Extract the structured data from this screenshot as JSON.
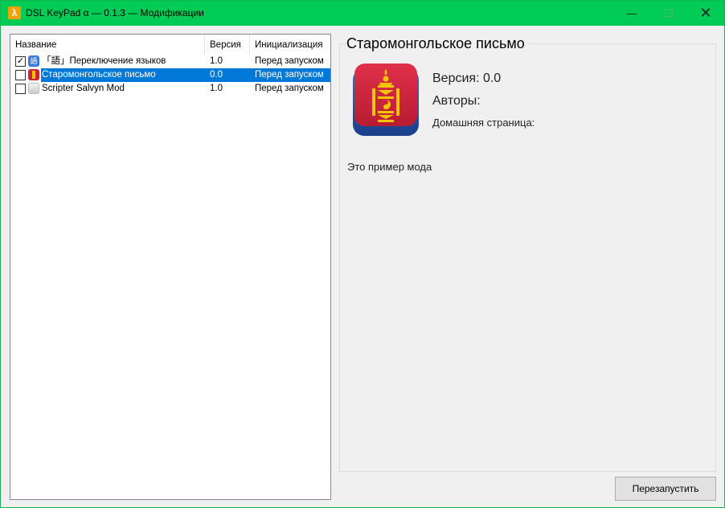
{
  "window": {
    "title": "DSL KeyPad α — 0.1.3 — Модификации",
    "app_icon_glyph": "λ",
    "minimize_glyph": "—",
    "maximize_glyph": "☐",
    "close_glyph": "✕",
    "titlebar_color": "#00cc55"
  },
  "list": {
    "columns": [
      "Название",
      "Версия",
      "Инициализация"
    ],
    "rows": [
      {
        "checked": "✓",
        "icon": "language-switch-icon",
        "icon_glyph": "語",
        "name": "「語」Переключение языков",
        "version": "1.0",
        "init": "Перед запуском"
      },
      {
        "checked": "",
        "icon": "mongolian-soyombo-icon",
        "icon_glyph": "",
        "name": "Старомонгольское письмо",
        "version": "0.0",
        "init": "Перед запуском"
      },
      {
        "checked": "",
        "icon": "script-icon",
        "icon_glyph": "",
        "name": "Scripter Salvyn Mod",
        "version": "1.0",
        "init": "Перед запуском"
      }
    ],
    "selected_row_color": "#0078d7"
  },
  "details": {
    "title": "Старомонгольское письмо",
    "version_line": "Версия: 0.0",
    "authors_line": "Авторы:",
    "homepage_line": "Домашняя страница:",
    "description": "Это пример мода"
  },
  "actions": {
    "restart_label": "Перезапустить"
  }
}
